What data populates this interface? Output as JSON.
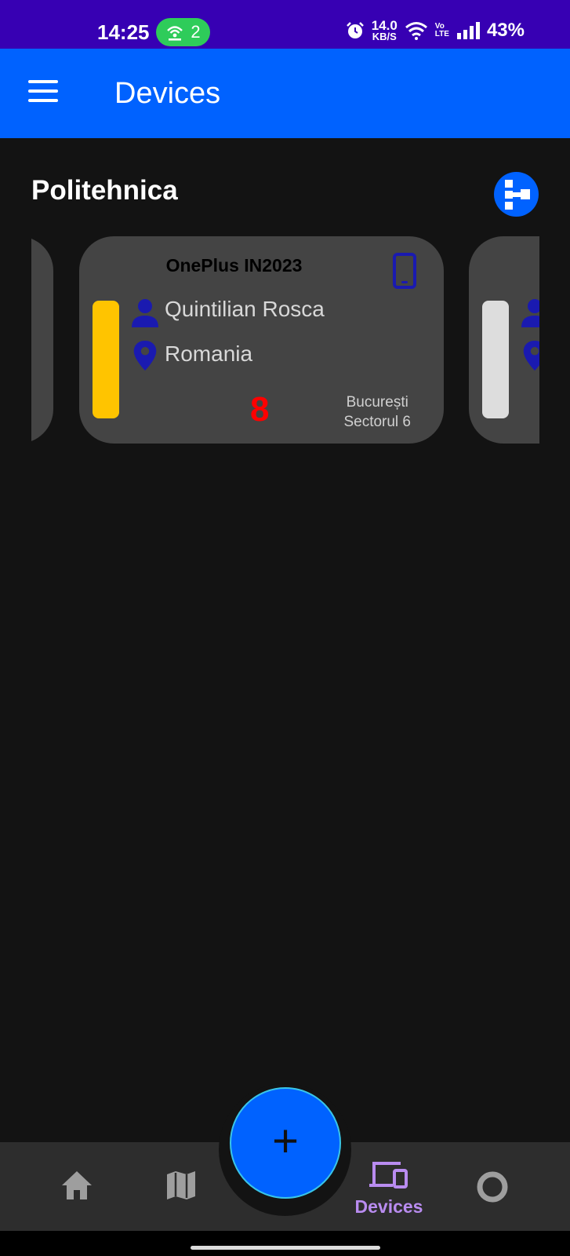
{
  "status_bar": {
    "time": "14:25",
    "hotspot_count": "2",
    "net_speed_value": "14.0",
    "net_speed_unit": "KB/S",
    "volte_top": "Vo",
    "volte_bottom": "LTE",
    "battery": "43%"
  },
  "app_bar": {
    "title": "Devices",
    "menu_icon": "hamburger-menu-icon"
  },
  "section": {
    "title": "Politehnica",
    "action_icon": "hierarchy-icon"
  },
  "devices": [
    {
      "name": "OnePlus IN2023",
      "owner": "Quintilian Rosca",
      "country": "Romania",
      "count": "8",
      "city": "București",
      "district": "Sectorul 6",
      "status_color": "#ffc400",
      "type_icon": "smartphone-icon"
    }
  ],
  "next_card": {
    "status_color": "#dddddd"
  },
  "colors": {
    "primary": "#0062ff",
    "status_bar": "#3700b3",
    "accent_nav": "#b98cf0",
    "icon_blue": "#1a1ab0",
    "count_red": "#ff0000"
  },
  "bottom_nav": {
    "items": [
      {
        "icon": "home-icon",
        "label": ""
      },
      {
        "icon": "map-icon",
        "label": ""
      },
      {
        "icon": "devices-icon",
        "label": "Devices",
        "active": true
      },
      {
        "icon": "circle-icon",
        "label": ""
      }
    ],
    "fab_label": "+"
  }
}
